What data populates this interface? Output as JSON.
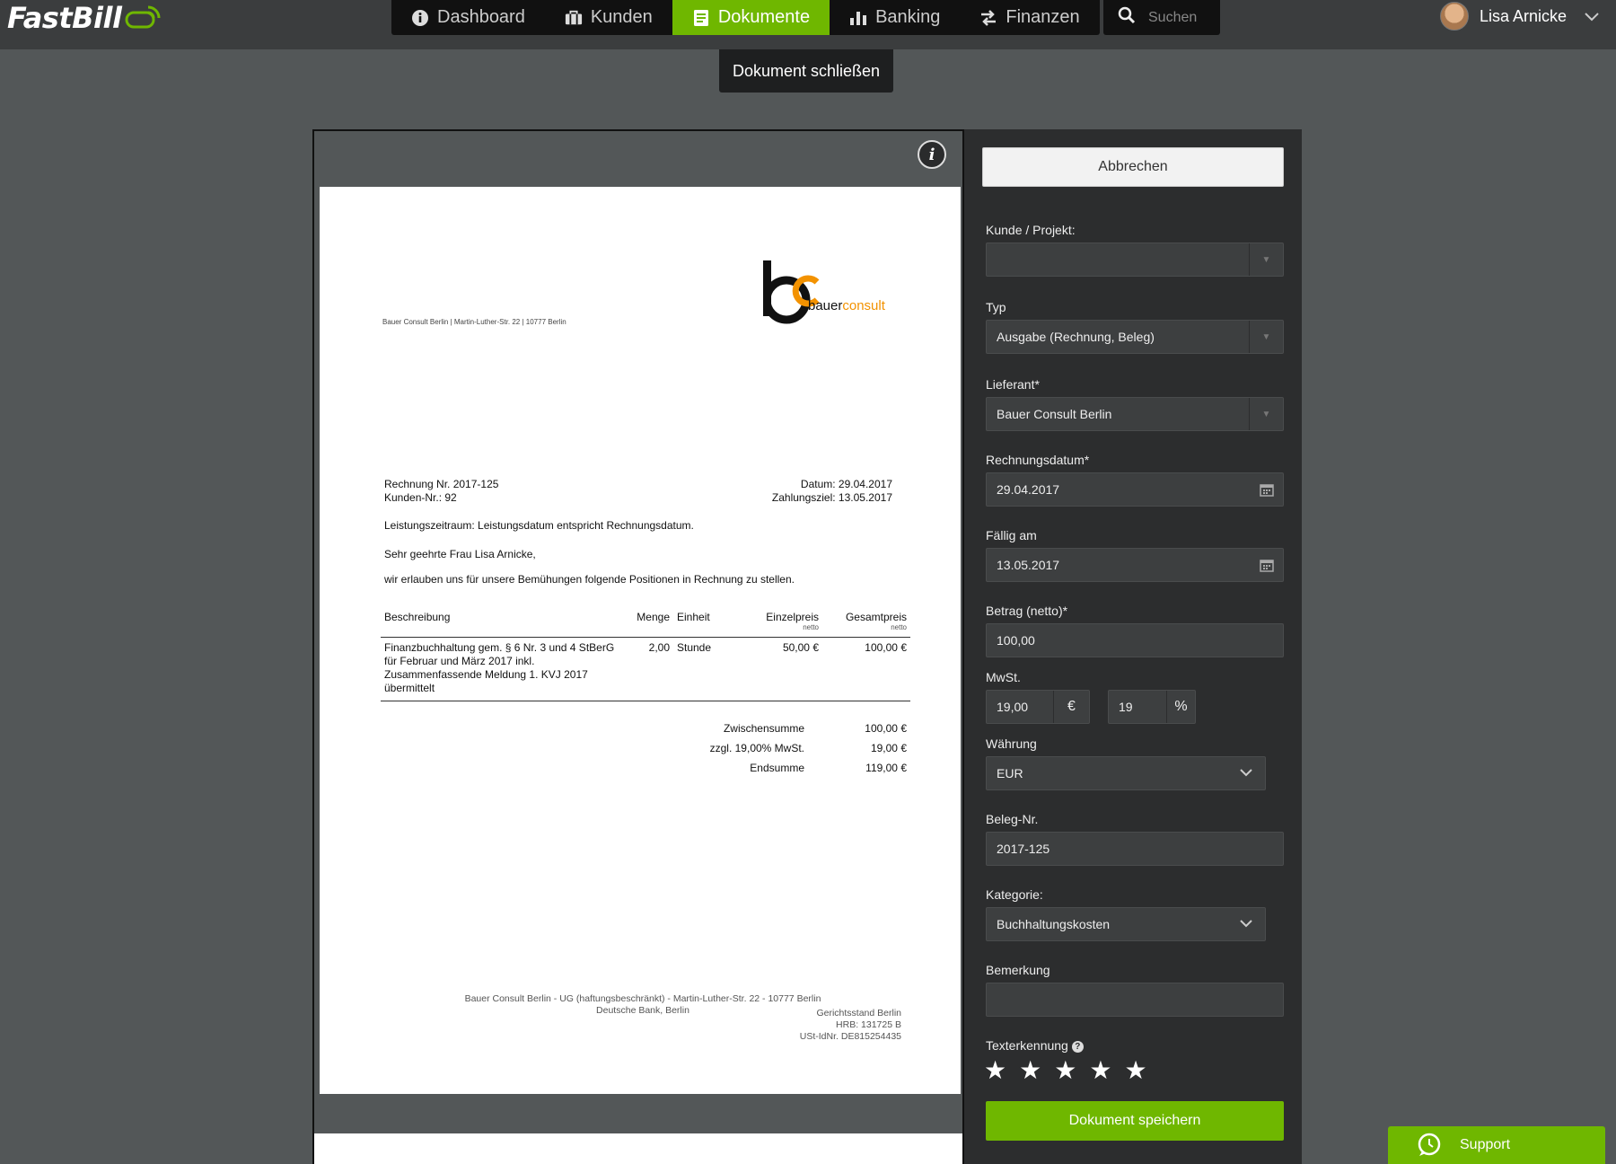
{
  "app": {
    "name": "FastBill"
  },
  "nav": [
    {
      "label": "Dashboard",
      "icon": "info-circle-icon"
    },
    {
      "label": "Kunden",
      "icon": "briefcase-icon"
    },
    {
      "label": "Dokumente",
      "icon": "document-icon",
      "active": true
    },
    {
      "label": "Banking",
      "icon": "bar-chart-icon"
    },
    {
      "label": "Finanzen",
      "icon": "transfer-arrows-icon"
    }
  ],
  "search": {
    "placeholder": "Suchen"
  },
  "user": {
    "name": "Lisa Arnicke"
  },
  "close_document": "Dokument schließen",
  "document": {
    "sender_line": "Bauer Consult Berlin | Martin-Luther-Str. 22 | 10777 Berlin",
    "brand": {
      "part1": "bauer",
      "part2": "consult"
    },
    "invoice_no": "Rechnung Nr. 2017-125",
    "customer_no": "Kunden-Nr.: 92",
    "date": "Datum: 29.04.2017",
    "due": "Zahlungsziel: 13.05.2017",
    "period": "Leistungszeitraum: Leistungsdatum entspricht Rechnungsdatum.",
    "salutation": "Sehr geehrte Frau Lisa Arnicke,",
    "intro": "wir erlauben uns für unsere Bemühungen folgende Positionen in Rechnung zu stellen.",
    "columns": {
      "description": "Beschreibung",
      "quantity": "Menge",
      "unit": "Einheit",
      "unit_price": "Einzelpreis",
      "unit_price_sub": "netto",
      "total": "Gesamtpreis",
      "total_sub": "netto"
    },
    "item": {
      "description": "Finanzbuchhaltung gem. § 6 Nr. 3 und 4 StBerG für Februar und März 2017 inkl. Zusammenfassende Meldung 1. KVJ 2017 übermittelt",
      "quantity": "2,00",
      "unit": "Stunde",
      "unit_price": "50,00 €",
      "total": "100,00 €"
    },
    "sums": [
      {
        "label": "Zwischensumme",
        "value": "100,00 €"
      },
      {
        "label": "zzgl. 19,00% MwSt.",
        "value": "19,00 €"
      },
      {
        "label": "Endsumme",
        "value": "119,00 €"
      }
    ],
    "footer": {
      "line1": "Bauer Consult Berlin - UG (haftungsbeschränkt) - Martin-Luther-Str. 22 - 10777 Berlin",
      "line2": "Deutsche Bank, Berlin",
      "right1": "Gerichtsstand Berlin",
      "right2": "HRB: 131725 B",
      "right3": "USt-IdNr. DE815254435"
    }
  },
  "form": {
    "cancel": "Abbrechen",
    "customer_label": "Kunde / Projekt:",
    "customer_value": "",
    "type_label": "Typ",
    "type_value": "Ausgabe (Rechnung, Beleg)",
    "supplier_label": "Lieferant*",
    "supplier_value": "Bauer Consult Berlin",
    "invoice_date_label": "Rechnungsdatum*",
    "invoice_date_value": "29.04.2017",
    "due_label": "Fällig am",
    "due_value": "13.05.2017",
    "amount_label": "Betrag (netto)*",
    "amount_value": "100,00",
    "vat_label": "MwSt.",
    "vat_amount": "19,00",
    "vat_currency": "€",
    "vat_rate": "19",
    "vat_percent": "%",
    "currency_label": "Währung",
    "currency_value": "EUR",
    "receipt_label": "Beleg-Nr.",
    "receipt_value": "2017-125",
    "category_label": "Kategorie:",
    "category_value": "Buchhaltungskosten",
    "note_label": "Bemerkung",
    "note_value": "",
    "ocr_label": "Texterkennung",
    "stars": 5,
    "save": "Dokument speichern"
  },
  "support": "Support",
  "colors": {
    "accent": "#6fb700",
    "brand_orange": "#f39200"
  }
}
